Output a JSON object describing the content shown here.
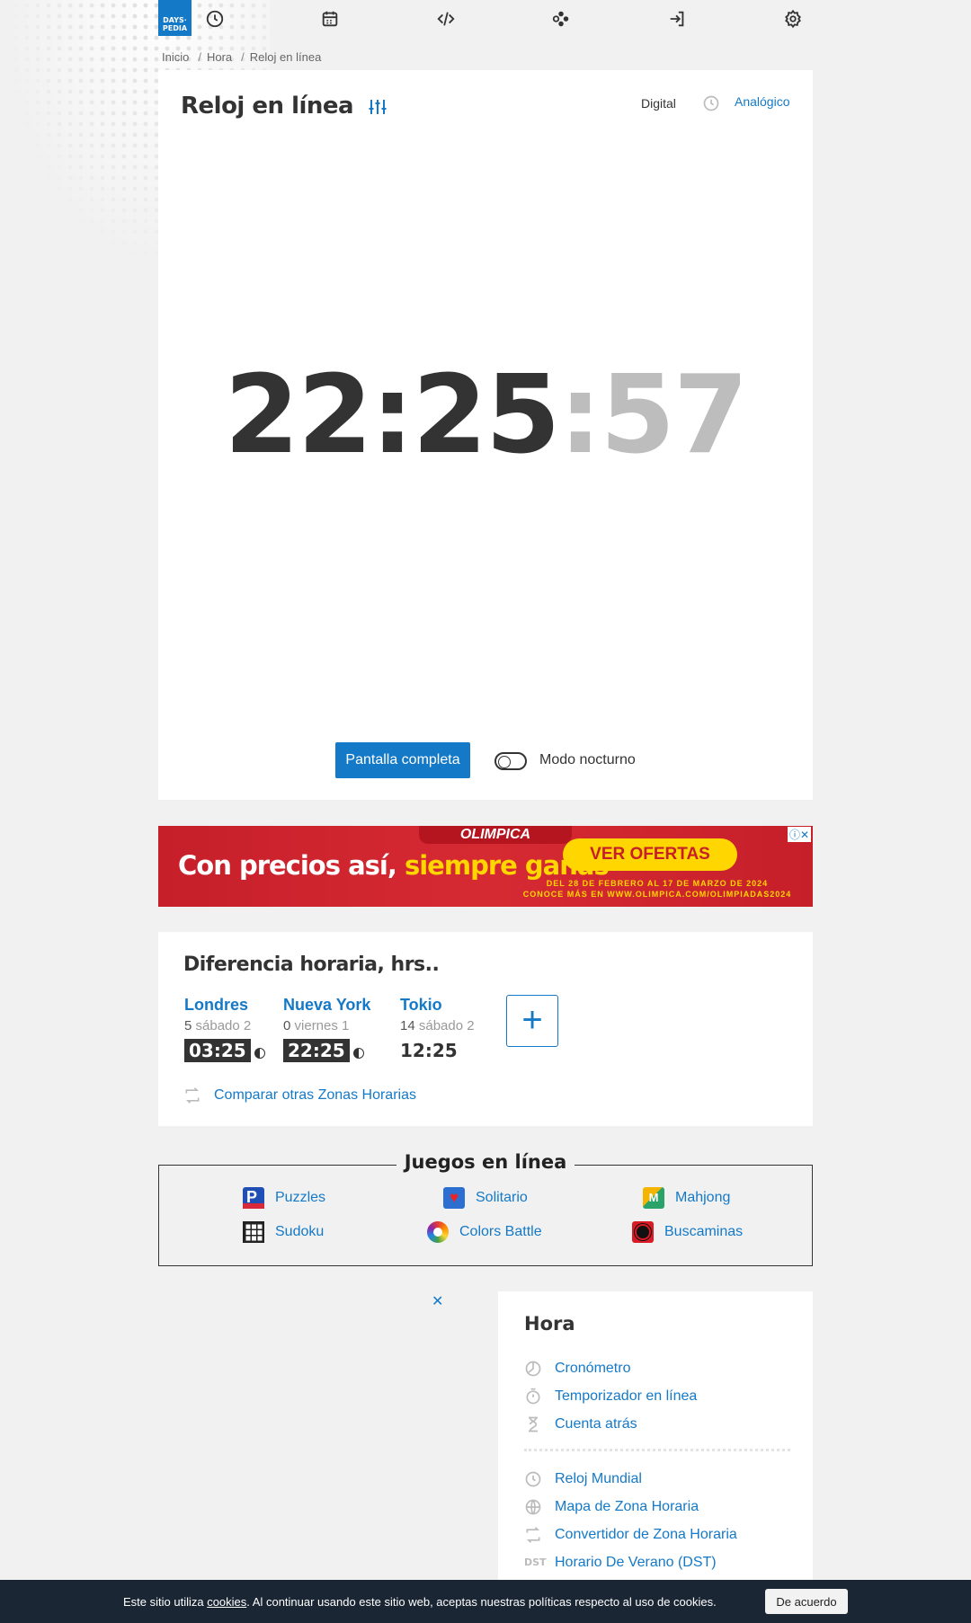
{
  "logo": {
    "line1": "DAYS·",
    "line2": "PEDIA"
  },
  "nav": {
    "icons": [
      "clock-icon",
      "calendar-icon",
      "code-icon",
      "gamepad-icon",
      "login-icon",
      "gear-icon"
    ]
  },
  "breadcrumb": {
    "items": [
      "Inicio",
      "Hora",
      "Reloj en línea"
    ],
    "separator": "/"
  },
  "clock": {
    "title": "Reloj en línea",
    "mode_digital": "Digital",
    "mode_analog": "Analógico",
    "hours_minutes": "22:25",
    "seconds": ":57",
    "fullscreen_label": "Pantalla completa",
    "night_mode_label": "Modo nocturno",
    "night_mode_on": false
  },
  "ad": {
    "brand": "OLIMPICA",
    "headline_a": "Con precios así, ",
    "headline_b": "siempre ganas",
    "cta": "VER OFERTAS",
    "fine1": "DEL 28 DE FEBRERO AL 17 DE MARZO DE 2024",
    "fine2": "CONOCE MÁS EN WWW.OLIMPICA.COM/OLIMPIADAS2024",
    "close": "ⓘ✕"
  },
  "timezones": {
    "title": "Diferencia horaria, hrs..",
    "cities": [
      {
        "name": "Londres",
        "offset": "5",
        "day": "sábado 2",
        "time": "03:25"
      },
      {
        "name": "Nueva York",
        "offset": "0",
        "day": "viernes 1",
        "time": "22:25"
      },
      {
        "name": "Tokio",
        "offset": "14",
        "day": "sábado 2",
        "time": "12:25"
      }
    ],
    "add_label": "+",
    "compare_label": "Comparar otras Zonas Horarias"
  },
  "games": {
    "title": "Juegos en línea",
    "items": [
      "Puzzles",
      "Solitario",
      "Mahjong",
      "Sudoku",
      "Colors Battle",
      "Buscaminas"
    ]
  },
  "sidebar": {
    "close": "✕",
    "title": "Hora",
    "links_top": [
      "Cronómetro",
      "Temporizador en línea",
      "Cuenta atrás"
    ],
    "links_bottom": [
      "Reloj Mundial",
      "Mapa de Zona Horaria",
      "Convertidor de Zona Horaria",
      "Horario De Verano (DST)"
    ],
    "dst_badge": "DST"
  },
  "cookie": {
    "text_a": "Este sitio utiliza ",
    "link": "cookies",
    "text_b": ". Al continuar usando este sitio web, aceptas nuestras políticas respecto al uso de cookies.",
    "accept": "De acuerdo"
  },
  "colors": {
    "accent": "#1479c7",
    "ad_red": "#c61f2a",
    "ad_yellow": "#ffd600",
    "cookie_bg": "#1b2635"
  }
}
